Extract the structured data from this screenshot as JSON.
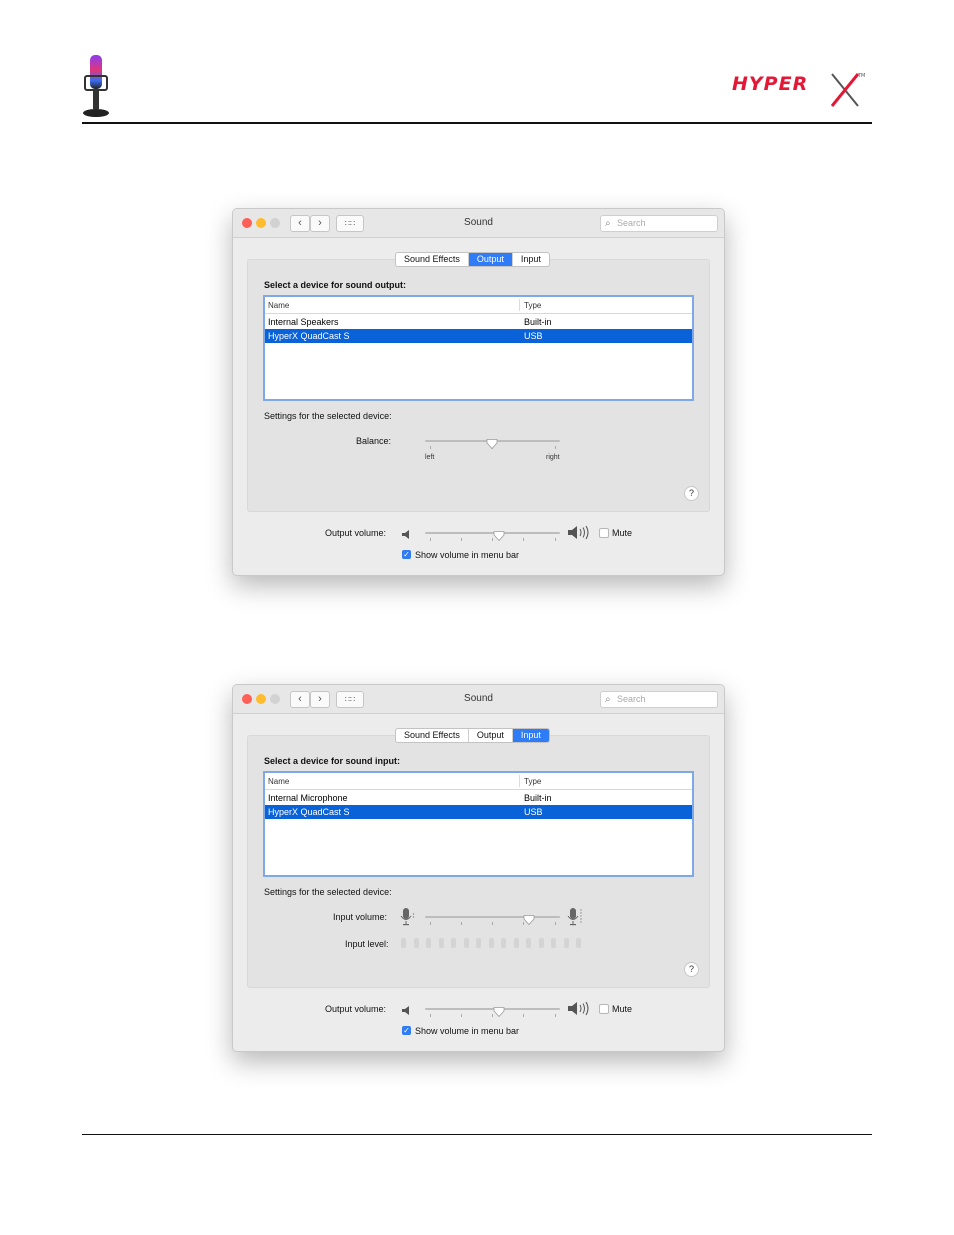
{
  "doc": {
    "brand_logo": "HyperX",
    "product_icon": "microphone-icon"
  },
  "windows": [
    {
      "title": "Sound",
      "search_placeholder": "Search",
      "tabs": [
        "Sound Effects",
        "Output",
        "Input"
      ],
      "selected_tab": "Output",
      "heading": "Select a device for sound output:",
      "columns": [
        "Name",
        "Type"
      ],
      "rows": [
        {
          "name": "Internal Speakers",
          "type": "Built-in"
        },
        {
          "name": "HyperX QuadCast S",
          "type": "USB",
          "selected": true
        }
      ],
      "settings_label": "Settings for the selected device:",
      "balance": {
        "label": "Balance:",
        "left": "left",
        "right": "right",
        "value": 0.5
      },
      "output_volume": {
        "label": "Output volume:",
        "value": 0.55
      },
      "mute_label": "Mute",
      "mute_checked": false,
      "show_volume_label": "Show volume in menu bar",
      "show_volume_checked": true
    },
    {
      "title": "Sound",
      "search_placeholder": "Search",
      "tabs": [
        "Sound Effects",
        "Output",
        "Input"
      ],
      "selected_tab": "Input",
      "heading": "Select a device for sound input:",
      "columns": [
        "Name",
        "Type"
      ],
      "rows": [
        {
          "name": "Internal Microphone",
          "type": "Built-in"
        },
        {
          "name": "HyperX QuadCast S",
          "type": "USB",
          "selected": true
        }
      ],
      "settings_label": "Settings for the selected device:",
      "input_volume": {
        "label": "Input volume:",
        "value": 0.77
      },
      "input_level": {
        "label": "Input level:",
        "value": 0
      },
      "output_volume": {
        "label": "Output volume:",
        "value": 0.55
      },
      "mute_label": "Mute",
      "mute_checked": false,
      "show_volume_label": "Show volume in menu bar",
      "show_volume_checked": true
    }
  ],
  "colors": {
    "accent": "#2f7cf6",
    "selection": "#0a62d8",
    "close": "#fe5f57",
    "minimize": "#febc2e",
    "zoom_disabled": "#d2d2d2"
  }
}
